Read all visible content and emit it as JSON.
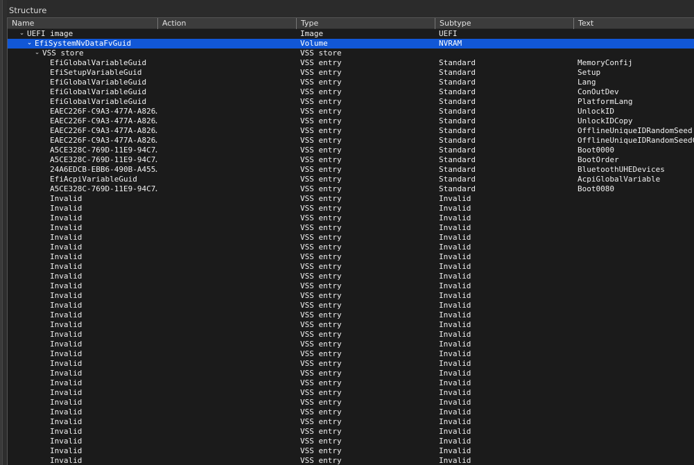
{
  "window": {
    "dock_title": "Structure"
  },
  "colors": {
    "selection": "#1157d6",
    "header_bg": "#3c3c3c",
    "body_bg": "#1b1b1b",
    "chrome_bg": "#2b2b2b",
    "text": "#f0f0f0"
  },
  "table": {
    "columns": [
      {
        "key": "name",
        "label": "Name"
      },
      {
        "key": "action",
        "label": "Action"
      },
      {
        "key": "type",
        "label": "Type"
      },
      {
        "key": "subtype",
        "label": "Subtype"
      },
      {
        "key": "text",
        "label": "Text"
      }
    ],
    "rows": [
      {
        "depth": 0,
        "expander": "⌄",
        "name": "UEFI image",
        "action": "",
        "type": "Image",
        "subtype": "UEFI",
        "text": "",
        "selected": false
      },
      {
        "depth": 1,
        "expander": "⌄",
        "name": "EfiSystemNvDataFvGuid",
        "action": "",
        "type": "Volume",
        "subtype": "NVRAM",
        "text": "",
        "selected": true
      },
      {
        "depth": 2,
        "expander": "⌄",
        "name": "VSS store",
        "action": "",
        "type": "VSS store",
        "subtype": "",
        "text": "",
        "selected": false
      },
      {
        "depth": 3,
        "expander": "",
        "name": "EfiGlobalVariableGuid",
        "action": "",
        "type": "VSS entry",
        "subtype": "Standard",
        "text": "MemoryConfij",
        "selected": false
      },
      {
        "depth": 3,
        "expander": "",
        "name": "EfiSetupVariableGuid",
        "action": "",
        "type": "VSS entry",
        "subtype": "Standard",
        "text": "Setup",
        "selected": false
      },
      {
        "depth": 3,
        "expander": "",
        "name": "EfiGlobalVariableGuid",
        "action": "",
        "type": "VSS entry",
        "subtype": "Standard",
        "text": "Lang",
        "selected": false
      },
      {
        "depth": 3,
        "expander": "",
        "name": "EfiGlobalVariableGuid",
        "action": "",
        "type": "VSS entry",
        "subtype": "Standard",
        "text": "ConOutDev",
        "selected": false
      },
      {
        "depth": 3,
        "expander": "",
        "name": "EfiGlobalVariableGuid",
        "action": "",
        "type": "VSS entry",
        "subtype": "Standard",
        "text": "PlatformLang",
        "selected": false
      },
      {
        "depth": 3,
        "expander": "",
        "name": "EAEC226F-C9A3-477A-A826…",
        "action": "",
        "type": "VSS entry",
        "subtype": "Standard",
        "text": "UnlockID",
        "selected": false
      },
      {
        "depth": 3,
        "expander": "",
        "name": "EAEC226F-C9A3-477A-A826…",
        "action": "",
        "type": "VSS entry",
        "subtype": "Standard",
        "text": "UnlockIDCopy",
        "selected": false
      },
      {
        "depth": 3,
        "expander": "",
        "name": "EAEC226F-C9A3-477A-A826…",
        "action": "",
        "type": "VSS entry",
        "subtype": "Standard",
        "text": "OfflineUniqueIDRandomSeed",
        "selected": false
      },
      {
        "depth": 3,
        "expander": "",
        "name": "EAEC226F-C9A3-477A-A826…",
        "action": "",
        "type": "VSS entry",
        "subtype": "Standard",
        "text": "OfflineUniqueIDRandomSeedCRC",
        "selected": false
      },
      {
        "depth": 3,
        "expander": "",
        "name": "A5CE328C-769D-11E9-94C7…",
        "action": "",
        "type": "VSS entry",
        "subtype": "Standard",
        "text": "Boot0000",
        "selected": false
      },
      {
        "depth": 3,
        "expander": "",
        "name": "A5CE328C-769D-11E9-94C7…",
        "action": "",
        "type": "VSS entry",
        "subtype": "Standard",
        "text": "BootOrder",
        "selected": false
      },
      {
        "depth": 3,
        "expander": "",
        "name": "24A6EDCB-EBB6-490B-A455…",
        "action": "",
        "type": "VSS entry",
        "subtype": "Standard",
        "text": "BluetoothUHEDevices",
        "selected": false
      },
      {
        "depth": 3,
        "expander": "",
        "name": "EfiAcpiVariableGuid",
        "action": "",
        "type": "VSS entry",
        "subtype": "Standard",
        "text": "AcpiGlobalVariable",
        "selected": false
      },
      {
        "depth": 3,
        "expander": "",
        "name": "A5CE328C-769D-11E9-94C7…",
        "action": "",
        "type": "VSS entry",
        "subtype": "Standard",
        "text": "Boot0080",
        "selected": false
      },
      {
        "depth": 3,
        "expander": "",
        "name": "Invalid",
        "action": "",
        "type": "VSS entry",
        "subtype": "Invalid",
        "text": "",
        "selected": false
      },
      {
        "depth": 3,
        "expander": "",
        "name": "Invalid",
        "action": "",
        "type": "VSS entry",
        "subtype": "Invalid",
        "text": "",
        "selected": false
      },
      {
        "depth": 3,
        "expander": "",
        "name": "Invalid",
        "action": "",
        "type": "VSS entry",
        "subtype": "Invalid",
        "text": "",
        "selected": false
      },
      {
        "depth": 3,
        "expander": "",
        "name": "Invalid",
        "action": "",
        "type": "VSS entry",
        "subtype": "Invalid",
        "text": "",
        "selected": false
      },
      {
        "depth": 3,
        "expander": "",
        "name": "Invalid",
        "action": "",
        "type": "VSS entry",
        "subtype": "Invalid",
        "text": "",
        "selected": false
      },
      {
        "depth": 3,
        "expander": "",
        "name": "Invalid",
        "action": "",
        "type": "VSS entry",
        "subtype": "Invalid",
        "text": "",
        "selected": false
      },
      {
        "depth": 3,
        "expander": "",
        "name": "Invalid",
        "action": "",
        "type": "VSS entry",
        "subtype": "Invalid",
        "text": "",
        "selected": false
      },
      {
        "depth": 3,
        "expander": "",
        "name": "Invalid",
        "action": "",
        "type": "VSS entry",
        "subtype": "Invalid",
        "text": "",
        "selected": false
      },
      {
        "depth": 3,
        "expander": "",
        "name": "Invalid",
        "action": "",
        "type": "VSS entry",
        "subtype": "Invalid",
        "text": "",
        "selected": false
      },
      {
        "depth": 3,
        "expander": "",
        "name": "Invalid",
        "action": "",
        "type": "VSS entry",
        "subtype": "Invalid",
        "text": "",
        "selected": false
      },
      {
        "depth": 3,
        "expander": "",
        "name": "Invalid",
        "action": "",
        "type": "VSS entry",
        "subtype": "Invalid",
        "text": "",
        "selected": false
      },
      {
        "depth": 3,
        "expander": "",
        "name": "Invalid",
        "action": "",
        "type": "VSS entry",
        "subtype": "Invalid",
        "text": "",
        "selected": false
      },
      {
        "depth": 3,
        "expander": "",
        "name": "Invalid",
        "action": "",
        "type": "VSS entry",
        "subtype": "Invalid",
        "text": "",
        "selected": false
      },
      {
        "depth": 3,
        "expander": "",
        "name": "Invalid",
        "action": "",
        "type": "VSS entry",
        "subtype": "Invalid",
        "text": "",
        "selected": false
      },
      {
        "depth": 3,
        "expander": "",
        "name": "Invalid",
        "action": "",
        "type": "VSS entry",
        "subtype": "Invalid",
        "text": "",
        "selected": false
      },
      {
        "depth": 3,
        "expander": "",
        "name": "Invalid",
        "action": "",
        "type": "VSS entry",
        "subtype": "Invalid",
        "text": "",
        "selected": false
      },
      {
        "depth": 3,
        "expander": "",
        "name": "Invalid",
        "action": "",
        "type": "VSS entry",
        "subtype": "Invalid",
        "text": "",
        "selected": false
      },
      {
        "depth": 3,
        "expander": "",
        "name": "Invalid",
        "action": "",
        "type": "VSS entry",
        "subtype": "Invalid",
        "text": "",
        "selected": false
      },
      {
        "depth": 3,
        "expander": "",
        "name": "Invalid",
        "action": "",
        "type": "VSS entry",
        "subtype": "Invalid",
        "text": "",
        "selected": false
      },
      {
        "depth": 3,
        "expander": "",
        "name": "Invalid",
        "action": "",
        "type": "VSS entry",
        "subtype": "Invalid",
        "text": "",
        "selected": false
      },
      {
        "depth": 3,
        "expander": "",
        "name": "Invalid",
        "action": "",
        "type": "VSS entry",
        "subtype": "Invalid",
        "text": "",
        "selected": false
      },
      {
        "depth": 3,
        "expander": "",
        "name": "Invalid",
        "action": "",
        "type": "VSS entry",
        "subtype": "Invalid",
        "text": "",
        "selected": false
      },
      {
        "depth": 3,
        "expander": "",
        "name": "Invalid",
        "action": "",
        "type": "VSS entry",
        "subtype": "Invalid",
        "text": "",
        "selected": false
      },
      {
        "depth": 3,
        "expander": "",
        "name": "Invalid",
        "action": "",
        "type": "VSS entry",
        "subtype": "Invalid",
        "text": "",
        "selected": false
      },
      {
        "depth": 3,
        "expander": "",
        "name": "Invalid",
        "action": "",
        "type": "VSS entry",
        "subtype": "Invalid",
        "text": "",
        "selected": false
      },
      {
        "depth": 3,
        "expander": "",
        "name": "Invalid",
        "action": "",
        "type": "VSS entry",
        "subtype": "Invalid",
        "text": "",
        "selected": false
      },
      {
        "depth": 3,
        "expander": "",
        "name": "Invalid",
        "action": "",
        "type": "VSS entry",
        "subtype": "Invalid",
        "text": "",
        "selected": false
      },
      {
        "depth": 3,
        "expander": "",
        "name": "Invalid",
        "action": "",
        "type": "VSS entry",
        "subtype": "Invalid",
        "text": "",
        "selected": false
      }
    ]
  }
}
